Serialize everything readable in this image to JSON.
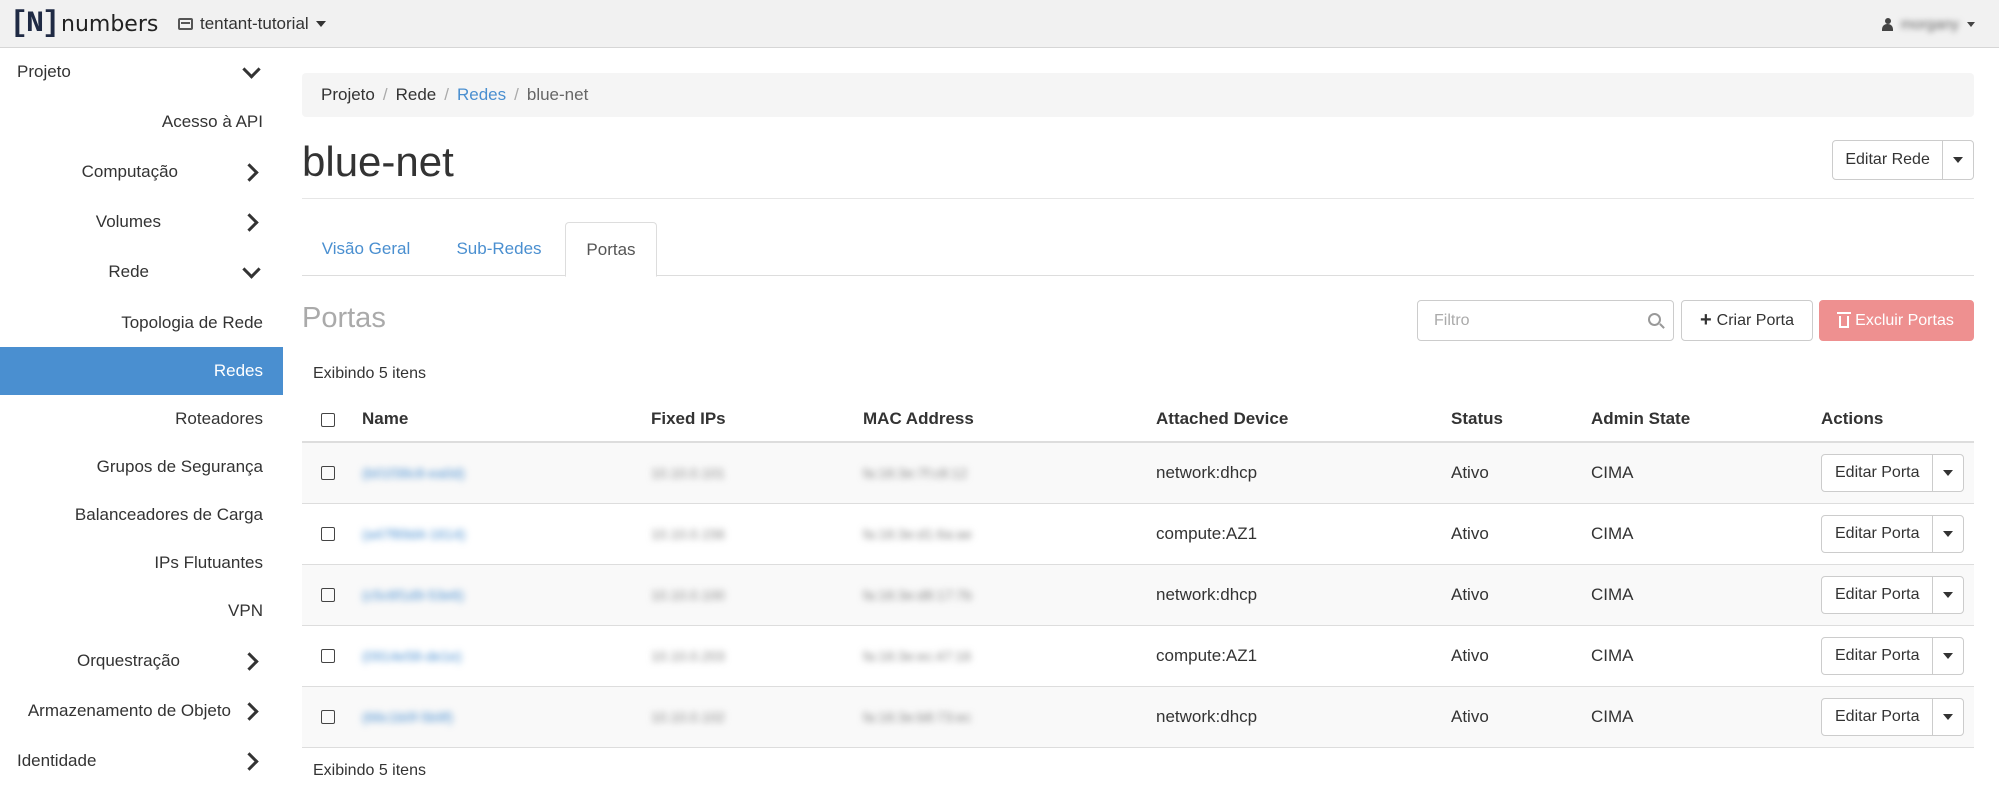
{
  "topbar": {
    "brand_mark": "[N]",
    "brand_text": "numbers",
    "project": "tentant-tutorial",
    "user": "morgany"
  },
  "sidebar": {
    "items": [
      {
        "label": "Projeto",
        "chevron": "down"
      },
      {
        "label": "Acesso à API"
      },
      {
        "label": "Computação",
        "chevron": "right"
      },
      {
        "label": "Volumes",
        "chevron": "right"
      },
      {
        "label": "Rede",
        "chevron": "down"
      },
      {
        "label": "Topologia de Rede"
      },
      {
        "label": "Redes",
        "active": true
      },
      {
        "label": "Roteadores"
      },
      {
        "label": "Grupos de Segurança"
      },
      {
        "label": "Balanceadores de Carga"
      },
      {
        "label": "IPs Flutuantes"
      },
      {
        "label": "VPN"
      },
      {
        "label": "Orquestração",
        "chevron": "right"
      },
      {
        "label": "Armazenamento de Objeto",
        "chevron": "right"
      },
      {
        "label": "Identidade",
        "chevron": "right"
      }
    ]
  },
  "breadcrumb": {
    "items": [
      "Projeto",
      "Rede",
      "Redes",
      "blue-net"
    ],
    "separator": "/"
  },
  "page": {
    "title": "blue-net",
    "edit_button": "Editar Rede"
  },
  "tabs": [
    "Visão Geral",
    "Sub-Redes",
    "Portas"
  ],
  "ports": {
    "title": "Portas",
    "filter_placeholder": "Filtro",
    "create_button": "Criar Porta",
    "delete_button": "Excluir Portas",
    "count_top": "Exibindo 5 itens",
    "count_bottom": "Exibindo 5 itens",
    "columns": [
      "Name",
      "Fixed IPs",
      "MAC Address",
      "Attached Device",
      "Status",
      "Admin State",
      "Actions"
    ],
    "rows": [
      {
        "name": "(b01f38c8-ea0d)",
        "ips": "10.10.0.101",
        "mac": "fa:16:3e:7f:c8:12",
        "device": "network:dhcp",
        "status": "Ativo",
        "admin": "CIMA",
        "action": "Editar Porta"
      },
      {
        "name": "(a47f89d4-1614)",
        "ips": "10.10.0.156",
        "mac": "fa:16:3e:d1:6a:ae",
        "device": "compute:AZ1",
        "status": "Ativo",
        "admin": "CIMA",
        "action": "Editar Porta"
      },
      {
        "name": "(c5c6f1d9-53e6)",
        "ips": "10.10.0.100",
        "mac": "fa:16:3e:d8:17:7b",
        "device": "network:dhcp",
        "status": "Ativo",
        "admin": "CIMA",
        "action": "Editar Porta"
      },
      {
        "name": "(0914e58-de1e)",
        "ips": "10.10.0.203",
        "mac": "fa:16:3e:ec:47:16",
        "device": "compute:AZ1",
        "status": "Ativo",
        "admin": "CIMA",
        "action": "Editar Porta"
      },
      {
        "name": "(66c1b0f-5b9f)",
        "ips": "10.10.0.102",
        "mac": "fa:16:3e:b8:73:ec",
        "device": "network:dhcp",
        "status": "Ativo",
        "admin": "CIMA",
        "action": "Editar Porta"
      }
    ]
  },
  "colors": {
    "accent": "#4a8fd0",
    "danger_button": "#ee9090",
    "topbar": "#f1f1f1"
  }
}
